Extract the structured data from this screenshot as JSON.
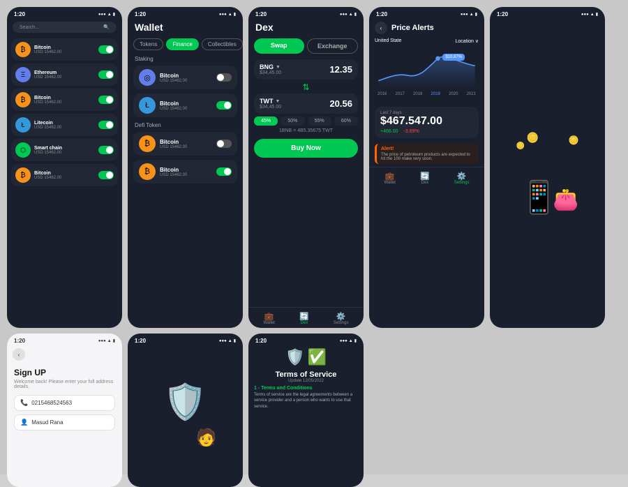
{
  "phones": {
    "phone1": {
      "status": {
        "time": "1:20",
        "signal": "●●●",
        "wifi": "▲",
        "battery": "▮"
      },
      "search_placeholder": "Search...",
      "coins": [
        {
          "name": "Bitcoin",
          "usd": "USD 15462.00",
          "icon": "₿",
          "color": "btc",
          "toggle": "green"
        },
        {
          "name": "Ethereum",
          "usd": "USD 15462.00",
          "icon": "Ξ",
          "color": "eth",
          "toggle": "green"
        },
        {
          "name": "Bitcoin",
          "usd": "USD 15462.00",
          "icon": "₿",
          "color": "btc",
          "toggle": "green"
        },
        {
          "name": "Litecoin",
          "usd": "USD 15462.00",
          "icon": "Ł",
          "color": "ltc",
          "toggle": "green"
        },
        {
          "name": "Smart chain",
          "usd": "USD 15462.00",
          "icon": "⬡",
          "color": "sc",
          "toggle": "green"
        },
        {
          "name": "Bitcoin",
          "usd": "USD 15462.00",
          "icon": "₿",
          "color": "btc",
          "toggle": "green"
        }
      ]
    },
    "phone2": {
      "status": {
        "time": "1:20",
        "signal": "●●●",
        "wifi": "▲",
        "battery": "▮"
      },
      "title": "Wallet",
      "tabs": [
        "Tokens",
        "Finance",
        "Collectibles"
      ],
      "active_tab": "Finance",
      "staking_label": "Staking",
      "defi_label": "Defi Token",
      "staking_items": [
        {
          "name": "Bitcoin",
          "usd": "USD 15462.00",
          "icon": "◎",
          "toggle": "gray"
        },
        {
          "name": "Bitcoin",
          "usd": "USD 15462.00",
          "icon": "Ł",
          "color": "blue",
          "toggle": "green"
        }
      ],
      "defi_items": [
        {
          "name": "Bitcoin",
          "usd": "USD 15462.00",
          "icon": "₿",
          "color": "btc",
          "toggle": "gray"
        },
        {
          "name": "Bitcoin",
          "usd": "USD 15462.00",
          "icon": "₿",
          "color": "btc",
          "toggle": "green"
        }
      ]
    },
    "phone3": {
      "status": {
        "time": "1:20",
        "signal": "●●●",
        "wifi": "▲",
        "battery": "▮"
      },
      "title": "Dex",
      "swap_label": "Swap",
      "exchange_label": "Exchange",
      "from_token": "BNG",
      "from_amount": "12.35",
      "from_usd": "$34,45.00",
      "to_token": "TWT",
      "to_amount": "20.56",
      "to_usd": "$34,45.00",
      "percentages": [
        "45%",
        "50%",
        "55%",
        "60%"
      ],
      "active_pct": "45%",
      "conversion": "1BNB = 4B5.35675 TWT",
      "buy_label": "Buy Now",
      "nav": [
        "Wallet",
        "Dex",
        "Settings"
      ]
    },
    "phone4": {
      "status": {
        "time": "1:20",
        "signal": "●●●",
        "wifi": "▲",
        "battery": "▮"
      },
      "title": "Price Alerts",
      "location": "United State",
      "location_selector": "Location ∨",
      "price_badge": "$10.87%",
      "chart_years": [
        "2016",
        "2017",
        "2018",
        "2019",
        "2020",
        "2021"
      ],
      "active_year": "2019",
      "period_label": "Last 7 days",
      "main_value": "$467.547.00",
      "change_up": "+466.00",
      "change_down": "-3.69%",
      "alert_head": "Alert!",
      "alert_text": "The price of petroleum products are expected to hit the 100 make very soon.",
      "nav": [
        "Wallet",
        "Dex",
        "Settings"
      ]
    },
    "phone5": {
      "status": {
        "time": "1:20",
        "signal": "●●●",
        "wifi": "▲",
        "battery": "▮"
      }
    },
    "phone6": {
      "status": {
        "time": "1:20",
        "signal": "●●●",
        "wifi": "▲",
        "battery": "▮"
      },
      "title": "Sign UP",
      "subtitle": "Welcome back! Please enter your full address details.",
      "phone_field": "0215468524563",
      "name_field": "Masud Rana"
    },
    "phone7": {
      "status": {
        "time": "1:20",
        "signal": "●●●",
        "wifi": "▲",
        "battery": "▮"
      }
    },
    "phone8": {
      "status": {
        "time": "1:20",
        "signal": "●●●",
        "wifi": "▲",
        "battery": "▮"
      },
      "title": "Terms of Service",
      "update": "Update 12/05/2022",
      "section1_title": "1 - Terms and Conditions",
      "section1_text": "Terms of service are the legal agreements between a service provider and a person who wants to use that service."
    }
  }
}
